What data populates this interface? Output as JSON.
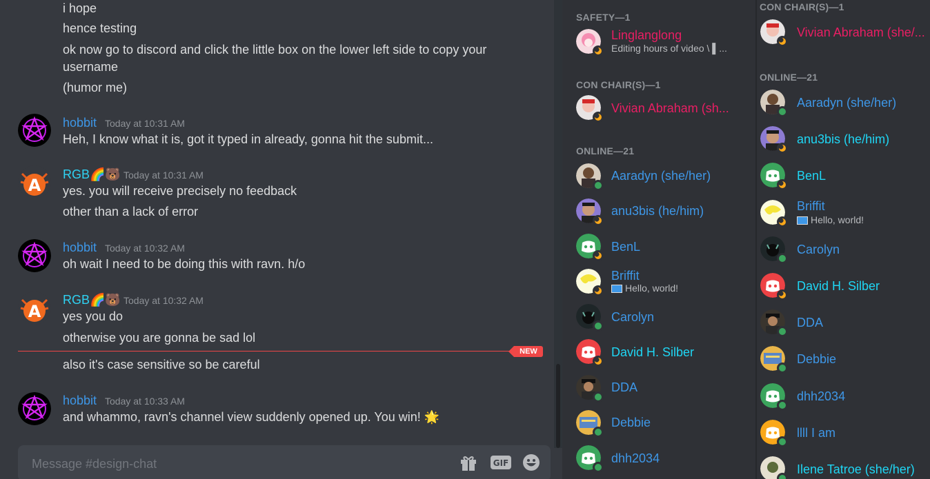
{
  "chat": {
    "continued_lines": [
      "i hope",
      "hence testing",
      "ok now go to discord and click the little box on the lower left side to copy your",
      "username",
      "(humor me)"
    ],
    "messages": [
      {
        "author": "hobbit",
        "timestamp": "Today at 10:31 AM",
        "lines": [
          "Heh, I know what it is, got it typed in already, gonna hit the submit..."
        ]
      },
      {
        "author": "RGB🌈🐻",
        "timestamp": "Today at 10:31 AM",
        "lines": [
          "yes. you will receive precisely no feedback",
          "other than a lack of error"
        ]
      },
      {
        "author": "hobbit",
        "timestamp": "Today at 10:32 AM",
        "lines": [
          "oh wait I need to be doing this with ravn.  h/o"
        ]
      },
      {
        "author": "RGB🌈🐻",
        "timestamp": "Today at 10:32 AM",
        "lines": [
          "yes you do",
          "otherwise you are gonna be sad lol",
          "also it's case sensitive so be careful"
        ]
      },
      {
        "author": "hobbit",
        "timestamp": "Today at 10:33 AM",
        "lines": [
          "and whammo, ravn's channel view suddenly opened up.  You win! 🌟"
        ]
      }
    ],
    "new_badge": "NEW",
    "composer_placeholder": "Message #design-chat"
  },
  "members_left": {
    "categories": [
      "SAFETY—1",
      "CON CHAIR(S)—1",
      "ONLINE—21"
    ],
    "members": [
      {
        "name": "Linglanglong",
        "activity": "Editing hours of video  \\ ▌...",
        "status": "idle"
      },
      {
        "name": "Vivian Abraham (sh...",
        "status": "idle"
      },
      {
        "name": "Aaradyn (she/her)",
        "status": "online"
      },
      {
        "name": "anu3bis (he/him)",
        "status": "idle"
      },
      {
        "name": "BenL",
        "status": "idle"
      },
      {
        "name": "Briffit",
        "activity": "Hello, world!",
        "status": "idle"
      },
      {
        "name": "Carolyn",
        "status": "online"
      },
      {
        "name": "David H. Silber",
        "status": "idle"
      },
      {
        "name": "DDA",
        "status": "online"
      },
      {
        "name": "Debbie",
        "status": "online"
      },
      {
        "name": "dhh2034",
        "status": "online"
      }
    ]
  },
  "members_right": {
    "categories": [
      "CON CHAIR(S)—1",
      "ONLINE—21"
    ],
    "members": [
      {
        "name": "Vivian Abraham (she/...",
        "status": "idle"
      },
      {
        "name": "Aaradyn (she/her)",
        "status": "online"
      },
      {
        "name": "anu3bis (he/him)",
        "status": "idle"
      },
      {
        "name": "BenL",
        "status": "idle"
      },
      {
        "name": "Briffit",
        "activity": "Hello, world!",
        "status": "idle"
      },
      {
        "name": "Carolyn",
        "status": "online"
      },
      {
        "name": "David H. Silber",
        "status": "idle"
      },
      {
        "name": "DDA",
        "status": "online"
      },
      {
        "name": "Debbie",
        "status": "online"
      },
      {
        "name": "dhh2034",
        "status": "online"
      },
      {
        "name": "llll I am",
        "status": "online"
      },
      {
        "name": "Ilene Tatroe (she/her)",
        "status": "online"
      }
    ]
  },
  "colors": {
    "chat_bg": "#36393f",
    "sidebar_bg": "#2f3136",
    "hobbit_color": "#3e97e7",
    "rgb_color": "#2fd2f2",
    "pink_role": "#e91e63",
    "new_red": "#f04747",
    "online_green": "#3ba55d",
    "idle_yellow": "#faa81a"
  }
}
